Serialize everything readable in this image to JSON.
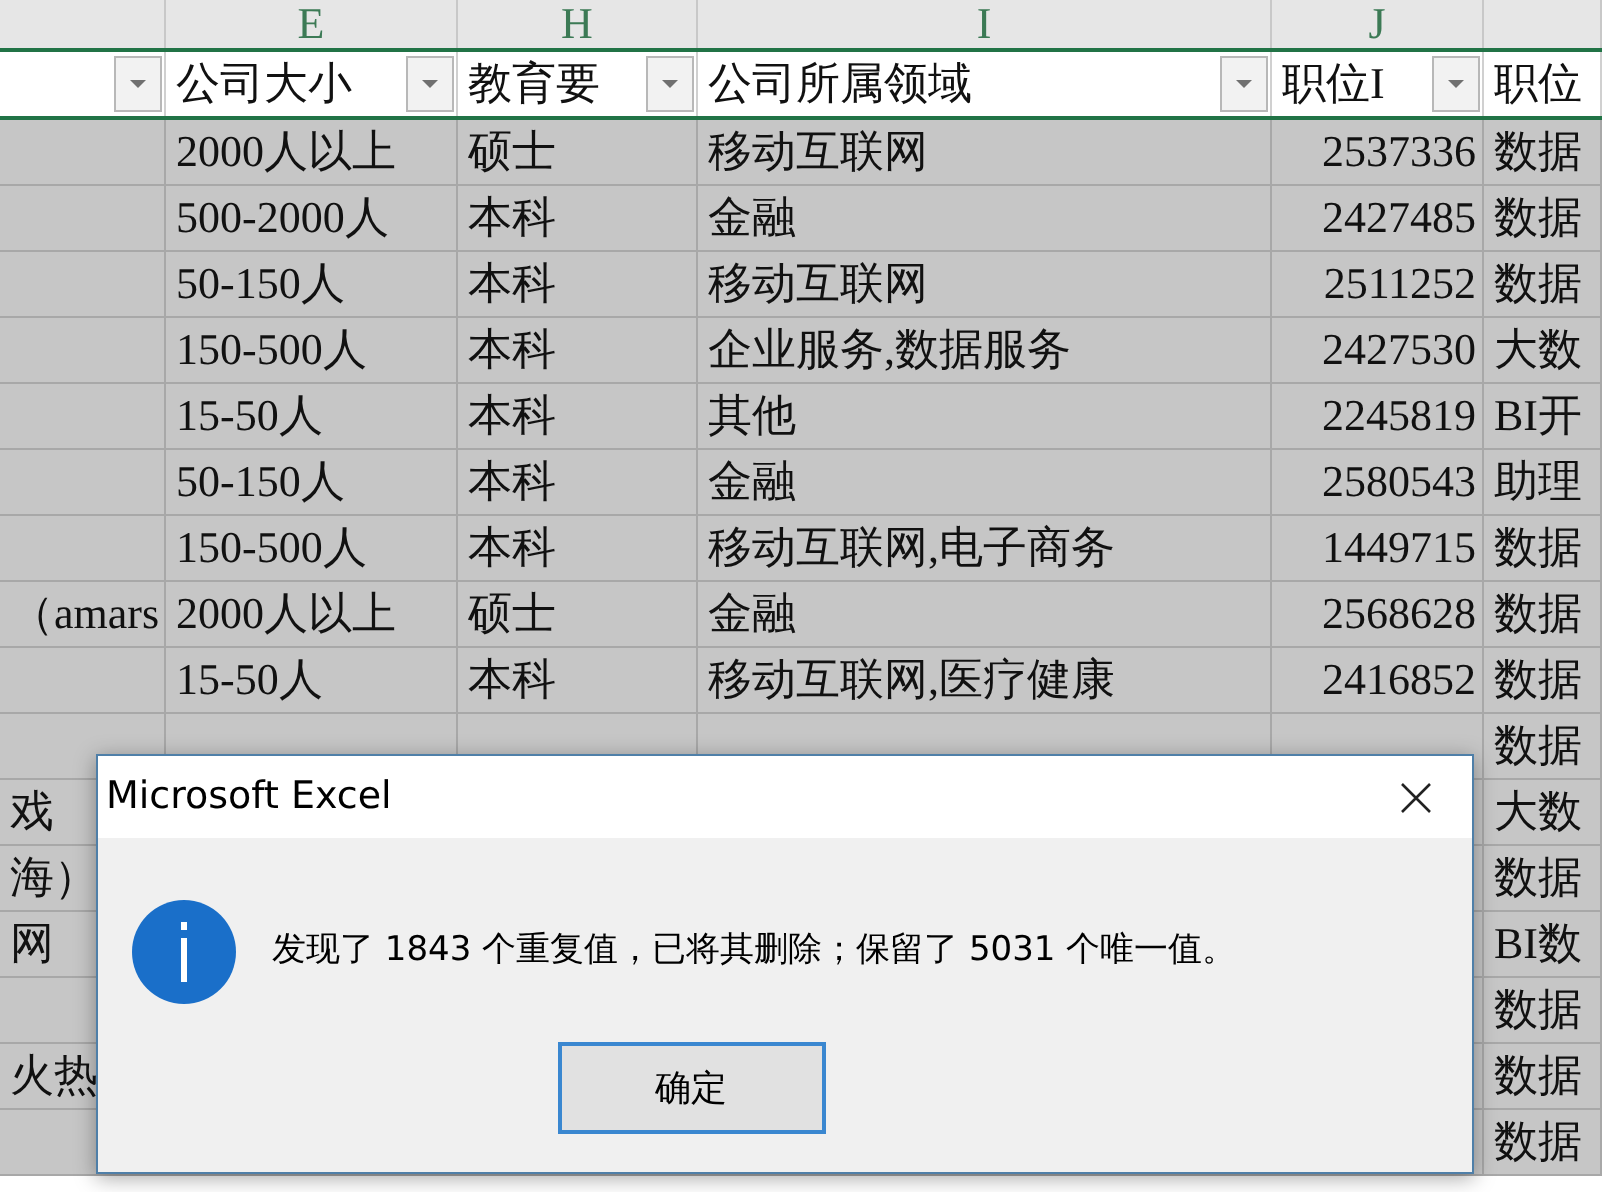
{
  "columns": [
    {
      "filter": true
    },
    {
      "letter": "E",
      "header": "公司大小",
      "filter": true
    },
    {
      "letter": "H",
      "header": "教育要",
      "filter": true
    },
    {
      "letter": "I",
      "header": "公司所属领域",
      "filter": true
    },
    {
      "letter": "J",
      "header": "职位I",
      "filter": true
    },
    {
      "header": "职位",
      "filter": false
    }
  ],
  "rows": [
    {
      "selected": true,
      "cells": [
        null,
        "2000人以上",
        "硕士",
        "移动互联网",
        "2537336",
        "数据"
      ]
    },
    {
      "selected": true,
      "cells": [
        null,
        "500-2000人",
        "本科",
        "金融",
        "2427485",
        "数据"
      ]
    },
    {
      "selected": true,
      "cells": [
        null,
        "50-150人",
        "本科",
        "移动互联网",
        "2511252",
        "数据"
      ]
    },
    {
      "selected": true,
      "cells": [
        null,
        "150-500人",
        "本科",
        "企业服务,数据服务",
        "2427530",
        "大数"
      ]
    },
    {
      "selected": true,
      "cells": [
        null,
        "15-50人",
        "本科",
        "其他",
        "2245819",
        "BI开"
      ]
    },
    {
      "selected": true,
      "cells": [
        null,
        "50-150人",
        "本科",
        "金融",
        "2580543",
        "助理"
      ]
    },
    {
      "selected": true,
      "cells": [
        null,
        "150-500人",
        "本科",
        "移动互联网,电子商务",
        "1449715",
        "数据"
      ]
    },
    {
      "selected": true,
      "cells": [
        "（amars",
        "2000人以上",
        "硕士",
        "金融",
        "2568628",
        "数据"
      ]
    },
    {
      "selected": true,
      "cells": [
        null,
        "15-50人",
        "本科",
        "移动互联网,医疗健康",
        "2416852",
        "数据"
      ]
    },
    {
      "selected": true,
      "cells": [
        null,
        null,
        null,
        null,
        null,
        "数据"
      ]
    },
    {
      "selected": true,
      "cells": [
        "戏",
        null,
        null,
        null,
        null,
        "大数"
      ]
    },
    {
      "selected": true,
      "cells": [
        "海）",
        null,
        null,
        null,
        null,
        "数据"
      ]
    },
    {
      "selected": true,
      "cells": [
        "网",
        null,
        null,
        null,
        null,
        "BI数"
      ]
    },
    {
      "selected": true,
      "cells": [
        null,
        null,
        null,
        null,
        null,
        "数据"
      ]
    },
    {
      "selected": true,
      "cells": [
        "火热",
        null,
        null,
        null,
        null,
        "数据"
      ]
    },
    {
      "selected": true,
      "cells": [
        null,
        null,
        null,
        null,
        null,
        "数据"
      ]
    }
  ],
  "dialog": {
    "title": "Microsoft Excel",
    "message": "发现了 1843 个重复值，已将其删除；保留了 5031 个唯一值。",
    "button": "确定"
  }
}
